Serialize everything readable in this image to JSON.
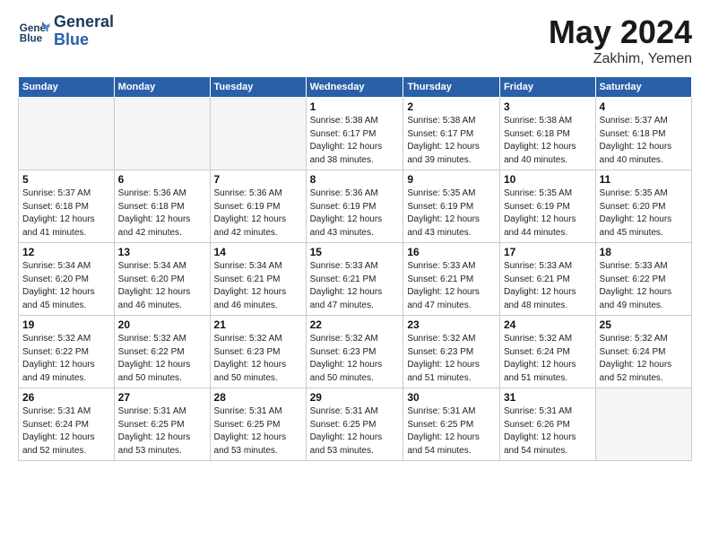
{
  "logo": {
    "line1": "General",
    "line2": "Blue"
  },
  "title": "May 2024",
  "location": "Zakhim, Yemen",
  "weekdays": [
    "Sunday",
    "Monday",
    "Tuesday",
    "Wednesday",
    "Thursday",
    "Friday",
    "Saturday"
  ],
  "weeks": [
    [
      {
        "day": "",
        "info": ""
      },
      {
        "day": "",
        "info": ""
      },
      {
        "day": "",
        "info": ""
      },
      {
        "day": "1",
        "info": "Sunrise: 5:38 AM\nSunset: 6:17 PM\nDaylight: 12 hours\nand 38 minutes."
      },
      {
        "day": "2",
        "info": "Sunrise: 5:38 AM\nSunset: 6:17 PM\nDaylight: 12 hours\nand 39 minutes."
      },
      {
        "day": "3",
        "info": "Sunrise: 5:38 AM\nSunset: 6:18 PM\nDaylight: 12 hours\nand 40 minutes."
      },
      {
        "day": "4",
        "info": "Sunrise: 5:37 AM\nSunset: 6:18 PM\nDaylight: 12 hours\nand 40 minutes."
      }
    ],
    [
      {
        "day": "5",
        "info": "Sunrise: 5:37 AM\nSunset: 6:18 PM\nDaylight: 12 hours\nand 41 minutes."
      },
      {
        "day": "6",
        "info": "Sunrise: 5:36 AM\nSunset: 6:18 PM\nDaylight: 12 hours\nand 42 minutes."
      },
      {
        "day": "7",
        "info": "Sunrise: 5:36 AM\nSunset: 6:19 PM\nDaylight: 12 hours\nand 42 minutes."
      },
      {
        "day": "8",
        "info": "Sunrise: 5:36 AM\nSunset: 6:19 PM\nDaylight: 12 hours\nand 43 minutes."
      },
      {
        "day": "9",
        "info": "Sunrise: 5:35 AM\nSunset: 6:19 PM\nDaylight: 12 hours\nand 43 minutes."
      },
      {
        "day": "10",
        "info": "Sunrise: 5:35 AM\nSunset: 6:19 PM\nDaylight: 12 hours\nand 44 minutes."
      },
      {
        "day": "11",
        "info": "Sunrise: 5:35 AM\nSunset: 6:20 PM\nDaylight: 12 hours\nand 45 minutes."
      }
    ],
    [
      {
        "day": "12",
        "info": "Sunrise: 5:34 AM\nSunset: 6:20 PM\nDaylight: 12 hours\nand 45 minutes."
      },
      {
        "day": "13",
        "info": "Sunrise: 5:34 AM\nSunset: 6:20 PM\nDaylight: 12 hours\nand 46 minutes."
      },
      {
        "day": "14",
        "info": "Sunrise: 5:34 AM\nSunset: 6:21 PM\nDaylight: 12 hours\nand 46 minutes."
      },
      {
        "day": "15",
        "info": "Sunrise: 5:33 AM\nSunset: 6:21 PM\nDaylight: 12 hours\nand 47 minutes."
      },
      {
        "day": "16",
        "info": "Sunrise: 5:33 AM\nSunset: 6:21 PM\nDaylight: 12 hours\nand 47 minutes."
      },
      {
        "day": "17",
        "info": "Sunrise: 5:33 AM\nSunset: 6:21 PM\nDaylight: 12 hours\nand 48 minutes."
      },
      {
        "day": "18",
        "info": "Sunrise: 5:33 AM\nSunset: 6:22 PM\nDaylight: 12 hours\nand 49 minutes."
      }
    ],
    [
      {
        "day": "19",
        "info": "Sunrise: 5:32 AM\nSunset: 6:22 PM\nDaylight: 12 hours\nand 49 minutes."
      },
      {
        "day": "20",
        "info": "Sunrise: 5:32 AM\nSunset: 6:22 PM\nDaylight: 12 hours\nand 50 minutes."
      },
      {
        "day": "21",
        "info": "Sunrise: 5:32 AM\nSunset: 6:23 PM\nDaylight: 12 hours\nand 50 minutes."
      },
      {
        "day": "22",
        "info": "Sunrise: 5:32 AM\nSunset: 6:23 PM\nDaylight: 12 hours\nand 50 minutes."
      },
      {
        "day": "23",
        "info": "Sunrise: 5:32 AM\nSunset: 6:23 PM\nDaylight: 12 hours\nand 51 minutes."
      },
      {
        "day": "24",
        "info": "Sunrise: 5:32 AM\nSunset: 6:24 PM\nDaylight: 12 hours\nand 51 minutes."
      },
      {
        "day": "25",
        "info": "Sunrise: 5:32 AM\nSunset: 6:24 PM\nDaylight: 12 hours\nand 52 minutes."
      }
    ],
    [
      {
        "day": "26",
        "info": "Sunrise: 5:31 AM\nSunset: 6:24 PM\nDaylight: 12 hours\nand 52 minutes."
      },
      {
        "day": "27",
        "info": "Sunrise: 5:31 AM\nSunset: 6:25 PM\nDaylight: 12 hours\nand 53 minutes."
      },
      {
        "day": "28",
        "info": "Sunrise: 5:31 AM\nSunset: 6:25 PM\nDaylight: 12 hours\nand 53 minutes."
      },
      {
        "day": "29",
        "info": "Sunrise: 5:31 AM\nSunset: 6:25 PM\nDaylight: 12 hours\nand 53 minutes."
      },
      {
        "day": "30",
        "info": "Sunrise: 5:31 AM\nSunset: 6:25 PM\nDaylight: 12 hours\nand 54 minutes."
      },
      {
        "day": "31",
        "info": "Sunrise: 5:31 AM\nSunset: 6:26 PM\nDaylight: 12 hours\nand 54 minutes."
      },
      {
        "day": "",
        "info": ""
      }
    ]
  ]
}
